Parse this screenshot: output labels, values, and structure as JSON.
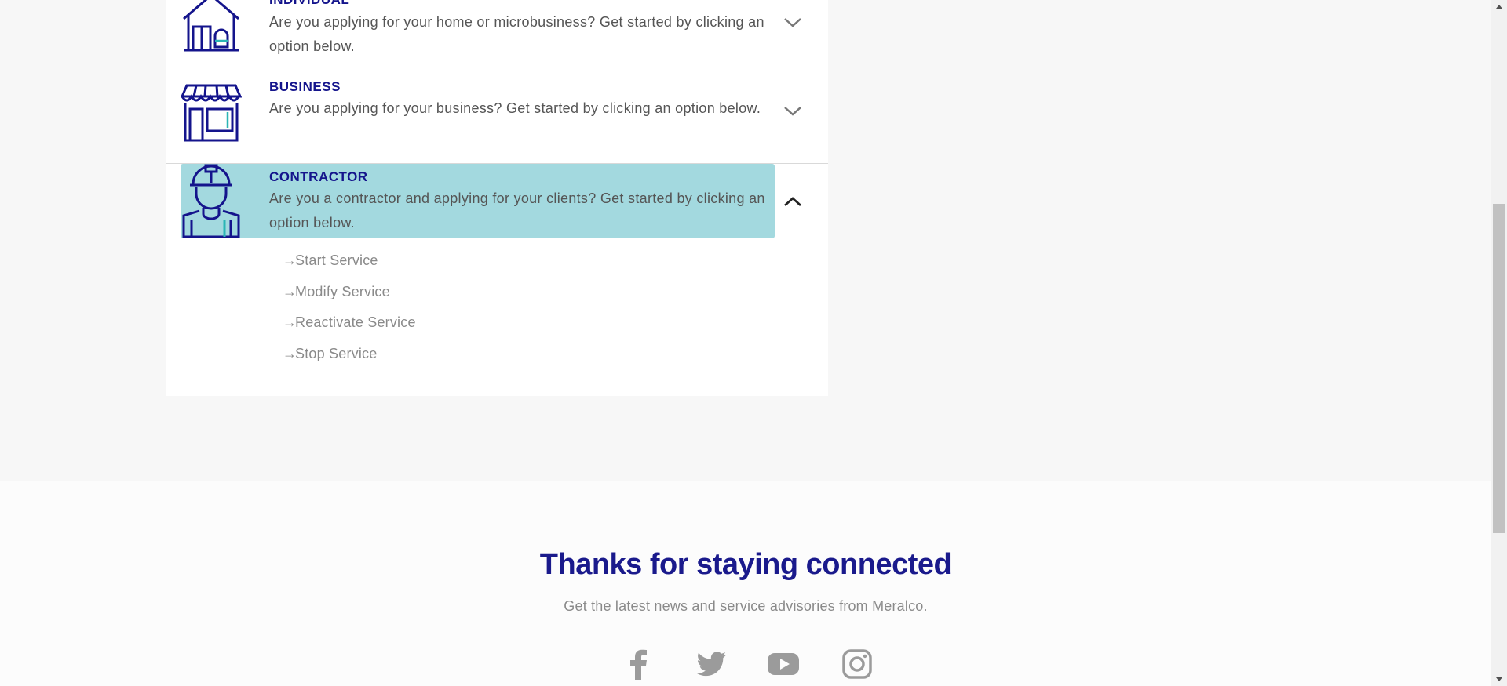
{
  "accordion": {
    "items": [
      {
        "title": "INDIVIDUAL",
        "description": "Are you applying for your home or microbusiness? Get started by clicking an option below.",
        "icon": "house-icon",
        "expanded": false
      },
      {
        "title": "BUSINESS",
        "description": "Are you applying for your business? Get started by clicking an option below.",
        "icon": "storefront-icon",
        "expanded": false
      },
      {
        "title": "CONTRACTOR",
        "description": "Are you a contractor and applying for your clients? Get started by clicking an option below.",
        "icon": "construction-worker-icon",
        "expanded": true
      }
    ],
    "contractor_options": [
      {
        "label": "Start Service"
      },
      {
        "label": "Modify Service"
      },
      {
        "label": "Reactivate Service"
      },
      {
        "label": "Stop Service"
      }
    ]
  },
  "footer": {
    "title": "Thanks for staying connected",
    "subtitle": "Get the latest news and service advisories from Meralco.",
    "social": [
      "facebook-icon",
      "twitter-icon",
      "youtube-icon",
      "instagram-icon"
    ]
  },
  "colors": {
    "brand_navy": "#14148c",
    "highlight": "#a3d9df",
    "accent_teal": "#2bb5b5",
    "muted_text": "#8a8a8a"
  }
}
